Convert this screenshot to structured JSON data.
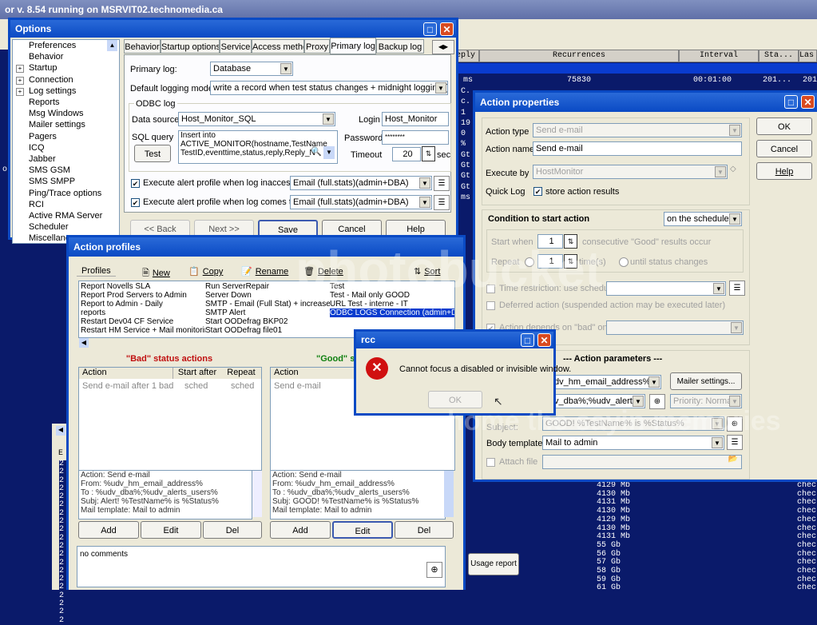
{
  "main_window": {
    "title": "or v. 8.54 running on MSRVIT02.technomedia.ca",
    "columns": [
      "eply",
      "Recurrences",
      "Interval",
      "Sta...",
      "Las"
    ],
    "row1": {
      "reply": "ms",
      "recurrences": "75830",
      "interval": "00:01:00",
      "status": "201...",
      "last": "201"
    },
    "left_letters": [
      "C.",
      "c.",
      "1",
      "19",
      "0",
      "%",
      "Gt",
      "Gt",
      "Gt",
      "Gt",
      "ms"
    ],
    "size_values": [
      "4129 Mb",
      "4130 Mb",
      "4131 Mb",
      "4130 Mb",
      "4129 Mb",
      "4130 Mb",
      "4131 Mb",
      "55 Gb",
      "56 Gb",
      "57 Gb",
      "58 Gb",
      "59 Gb",
      "61 Gb"
    ],
    "status_values": [
      "chec",
      "chec",
      "chec",
      "chec",
      "chec",
      "chec",
      "chec",
      "chec",
      "chec",
      "chec",
      "chec",
      "chec",
      "chec"
    ],
    "left_digits": [
      "2",
      "2",
      "2",
      "2",
      "2",
      "2",
      "2",
      "2",
      "2",
      "2",
      "2",
      "2",
      "2",
      "2",
      "2",
      "2",
      "2",
      "2",
      "2",
      "2"
    ],
    "left_pane_letter": "E",
    "left_dot": "o"
  },
  "options": {
    "title": "Options",
    "tree": [
      "Preferences",
      "Behavior",
      "Startup",
      "Connection",
      "Log settings",
      "Reports",
      "Msg Windows",
      "Mailer settings",
      "Pagers",
      "ICQ",
      "Jabber",
      "SMS GSM",
      "SMS SMPP",
      "Ping/Trace options",
      "RCI",
      "Active RMA Server",
      "Scheduler",
      "Miscellaneo"
    ],
    "tabs": [
      "Behavior",
      "Startup options",
      "Service",
      "Access method",
      "Proxy",
      "Primary log",
      "Backup log"
    ],
    "primary_log_label": "Primary log:",
    "primary_log_value": "Database",
    "default_mode_label": "Default logging mode:",
    "default_mode_value": "write a record when test status changes + midnight logging (Midnig",
    "odbc_group": "ODBC log",
    "data_source_label": "Data source",
    "data_source_value": "Host_Monitor_SQL",
    "login_label": "Login",
    "login_value": "Host_Monitor",
    "sql_label": "SQL query",
    "sql_lines": [
      "Insert into",
      "ACTIVE_MONITOR(hostname,TestName",
      "TestID,eventtime,status,reply,Reply_N"
    ],
    "password_label": "Password",
    "password_value": "********",
    "test_button": "Test",
    "timeout_label": "Timeout",
    "timeout_value": "20",
    "sec_label": "sec",
    "alert1_label": "Execute alert profile when log inaccessible",
    "alert1_value": "Email (full.stats)(admin+DBA)",
    "alert2_label": "Execute alert profile when log comes to life",
    "alert2_value": "Email (full.stats)(admin+DBA)",
    "back": "<< Back",
    "next": "Next >>",
    "save": "Save",
    "cancel": "Cancel",
    "help": "Help"
  },
  "profiles": {
    "title": "Action profiles",
    "toolbar": [
      "Profiles",
      "New",
      "Copy",
      "Rename",
      "Delete",
      "Sort"
    ],
    "col1": [
      "Report Novells SLA",
      "Report Prod Servers to Admin",
      "Report to Admin - Daily",
      "reports",
      "Restart Dev04 CF Service",
      "Restart HM Service + Mail monitoring"
    ],
    "col2": [
      "Run ServerRepair",
      "Server Down",
      "SMTP - Email (Full Stat) + increase Ti",
      "SMTP Alert",
      "Start OODefrag BKP02",
      "Start OODefrag file01"
    ],
    "col3": [
      "Test",
      "Test - Mail only GOOD",
      "URL Test - interne - IT",
      "ODBC LOGS Connection (admin+DBA",
      "",
      ""
    ],
    "bad_header": "\"Bad\" status actions",
    "good_header": "\"Good\" s",
    "bad_cols": [
      "Action",
      "Start after",
      "Repeat"
    ],
    "good_cols": [
      "Action"
    ],
    "bad_row": [
      "Send e-mail after 1 bad",
      "sched",
      "sched"
    ],
    "good_row": [
      "Send e-mail"
    ],
    "bad_detail": [
      "Action: Send e-mail",
      "From: %udv_hm_email_address%",
      "To  : %udv_dba%;%udv_alerts_users%",
      "Subj: Alert! %TestName% is %Status%",
      "Mail template: Mail to admin"
    ],
    "good_detail": [
      "Action: Send e-mail",
      "From: %udv_hm_email_address%",
      "To  : %udv_dba%;%udv_alerts_users%",
      "Subj: GOOD! %TestName% is %Status%",
      "Mail template: Mail to admin"
    ],
    "add": "Add",
    "edit": "Edit",
    "del": "Del",
    "comments": "no comments",
    "usage_report": "Usage report"
  },
  "action_props": {
    "title": "Action properties",
    "action_type_label": "Action type",
    "action_type_value": "Send e-mail",
    "action_name_label": "Action name",
    "action_name_value": "Send e-mail",
    "execute_by_label": "Execute by",
    "execute_by_value": "HostMonitor",
    "quick_log_label": "Quick Log",
    "store_label": "store action results",
    "ok": "OK",
    "cancel": "Cancel",
    "help": "Help",
    "condition_label": "Condition to start action",
    "condition_value": "on the schedule",
    "start_when_label": "Start when",
    "start_when_value": "1",
    "consecutive_label": "consecutive \"Good\" results occur",
    "repeat_label": "Repeat",
    "repeat_value": "1",
    "times_label": "time(s)",
    "until_label": "until status changes",
    "time_restriction_label": "Time restriction: use schedule",
    "deferred_label": "Deferred action (suspended action may be executed later)",
    "depends_label": "Action depends on \"bad\" one",
    "params_label": "---  Action parameters  ---",
    "to_value": "dv_hm_email_address%",
    "mailer_btn": "Mailer settings...",
    "cc_value": "v_dba%;%udv_alerts_",
    "priority_value": "Priority: Normal",
    "subject_label": "Subject:",
    "subject_value": "GOOD! %TestName% is %Status%",
    "body_label": "Body template",
    "body_value": "Mail to admin",
    "attach_label": "Attach file"
  },
  "dialog": {
    "title": "rcc",
    "message": "Cannot focus a disabled or invisible window.",
    "ok": "OK"
  },
  "watermark": {
    "top": "photobucket",
    "bottom": "home the sayin memories"
  }
}
